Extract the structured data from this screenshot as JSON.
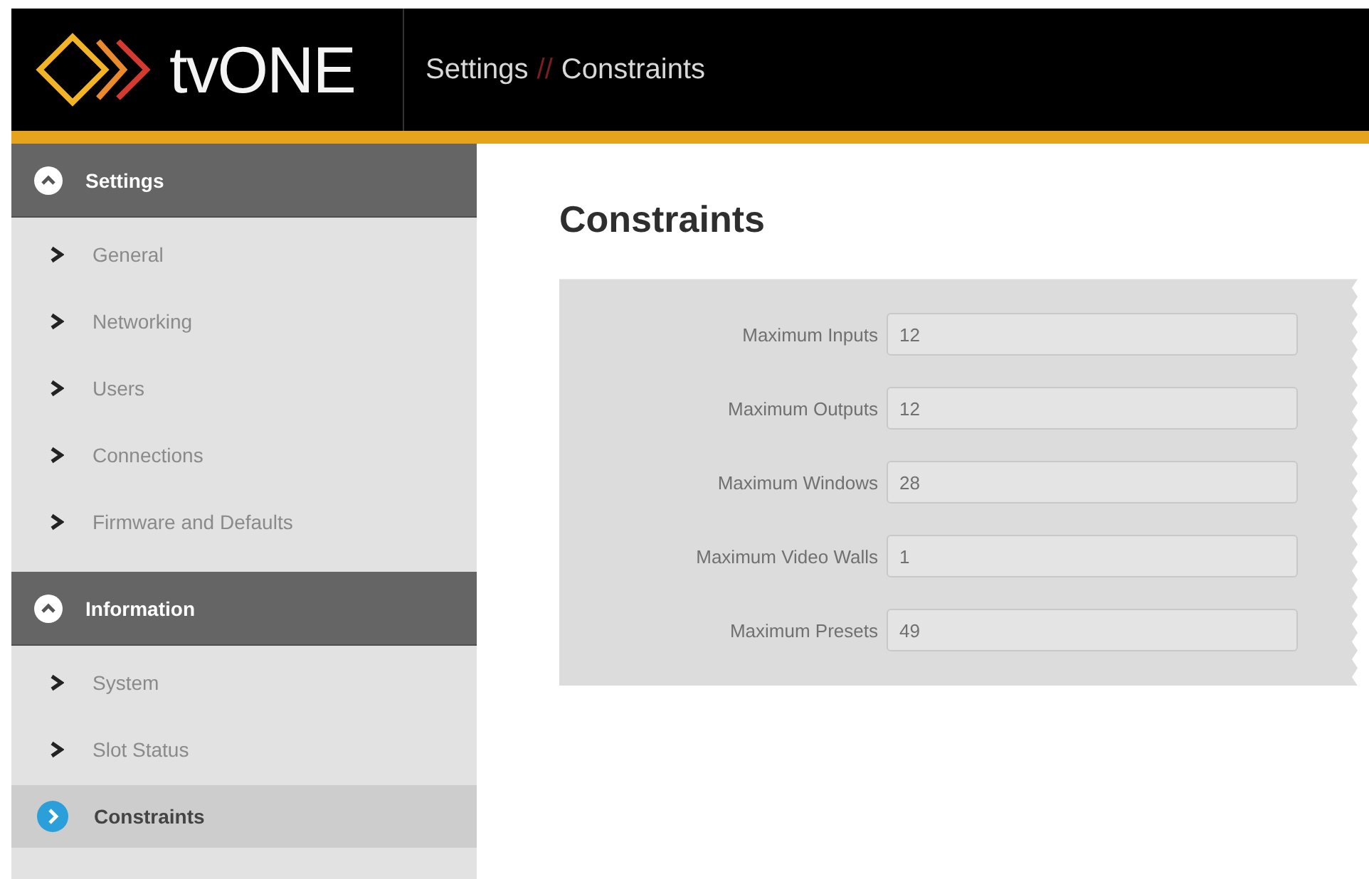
{
  "header": {
    "brand": "tvONE",
    "breadcrumb": [
      "Settings",
      "Constraints"
    ],
    "separator": "//"
  },
  "sidebar": {
    "sections": [
      {
        "title": "Settings",
        "expanded": true,
        "items": [
          {
            "label": "General",
            "selected": false
          },
          {
            "label": "Networking",
            "selected": false
          },
          {
            "label": "Users",
            "selected": false
          },
          {
            "label": "Connections",
            "selected": false
          },
          {
            "label": "Firmware and Defaults",
            "selected": false
          }
        ]
      },
      {
        "title": "Information",
        "expanded": true,
        "items": [
          {
            "label": "System",
            "selected": false
          },
          {
            "label": "Slot Status",
            "selected": false
          },
          {
            "label": "Constraints",
            "selected": true
          }
        ]
      }
    ]
  },
  "content": {
    "title": "Constraints",
    "fields": [
      {
        "label": "Maximum Inputs",
        "value": "12"
      },
      {
        "label": "Maximum Outputs",
        "value": "12"
      },
      {
        "label": "Maximum Windows",
        "value": "28"
      },
      {
        "label": "Maximum Video Walls",
        "value": "1"
      },
      {
        "label": "Maximum Presets",
        "value": "49"
      }
    ]
  }
}
